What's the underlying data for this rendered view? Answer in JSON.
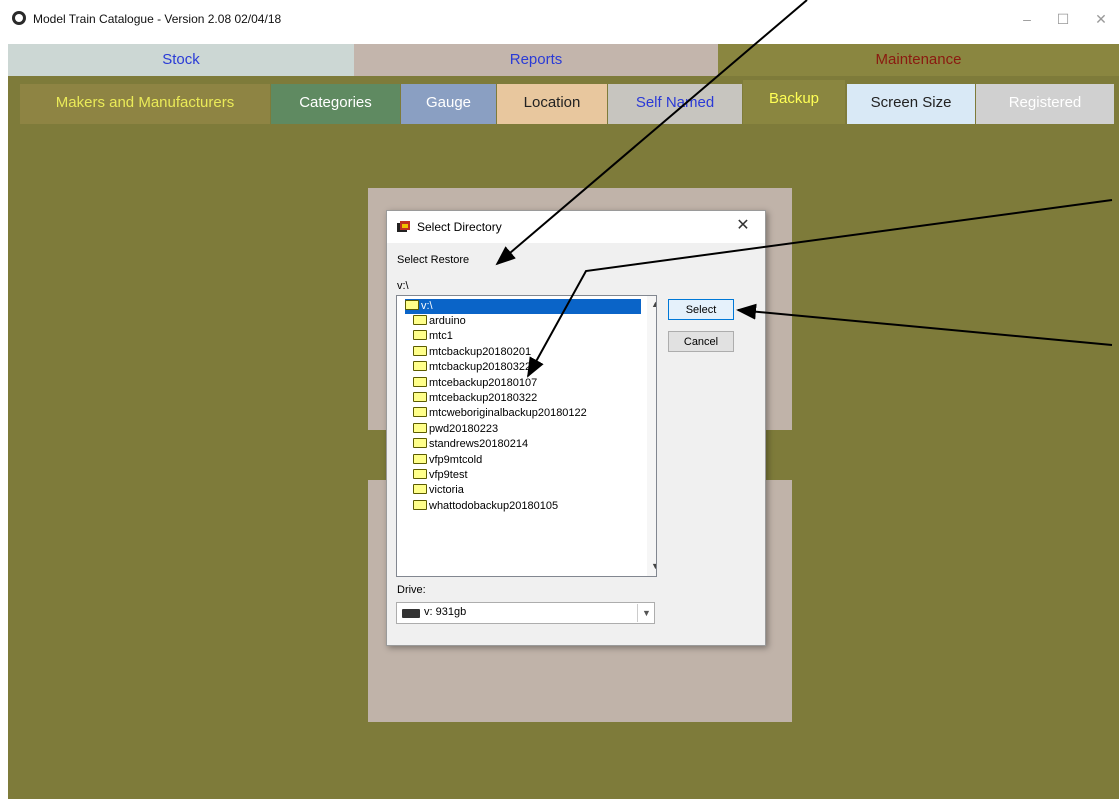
{
  "window": {
    "title": "Model Train Catalogue - Version 2.08  02/04/18",
    "min": "–",
    "max": "☐",
    "close": "✕"
  },
  "main_tabs": [
    {
      "label": "Stock"
    },
    {
      "label": "Reports"
    },
    {
      "label": "Maintenance"
    }
  ],
  "sub_tabs": [
    {
      "label": "Makers and Manufacturers"
    },
    {
      "label": "Categories"
    },
    {
      "label": "Gauge"
    },
    {
      "label": "Location"
    },
    {
      "label": "Self Named"
    },
    {
      "label": "Backup"
    },
    {
      "label": "Screen Size"
    },
    {
      "label": "Registered"
    }
  ],
  "dialog": {
    "title": "Select Directory",
    "close": "✕",
    "prompt": "Select Restore",
    "current_path": "v:\\",
    "root": "v:\\",
    "folders": [
      "arduino",
      "mtc1",
      "mtcbackup20180201",
      "mtcbackup20180322",
      "mtcebackup20180107",
      "mtcebackup20180322",
      "mtcweboriginalbackup20180122",
      "pwd20180223",
      "standrews20180214",
      "vfp9mtcold",
      "vfp9test",
      "victoria",
      "whattodobackup20180105"
    ],
    "select_button": "Select",
    "cancel_button": "Cancel",
    "drive_label": "Drive:",
    "drive_value": "v: 931gb"
  }
}
